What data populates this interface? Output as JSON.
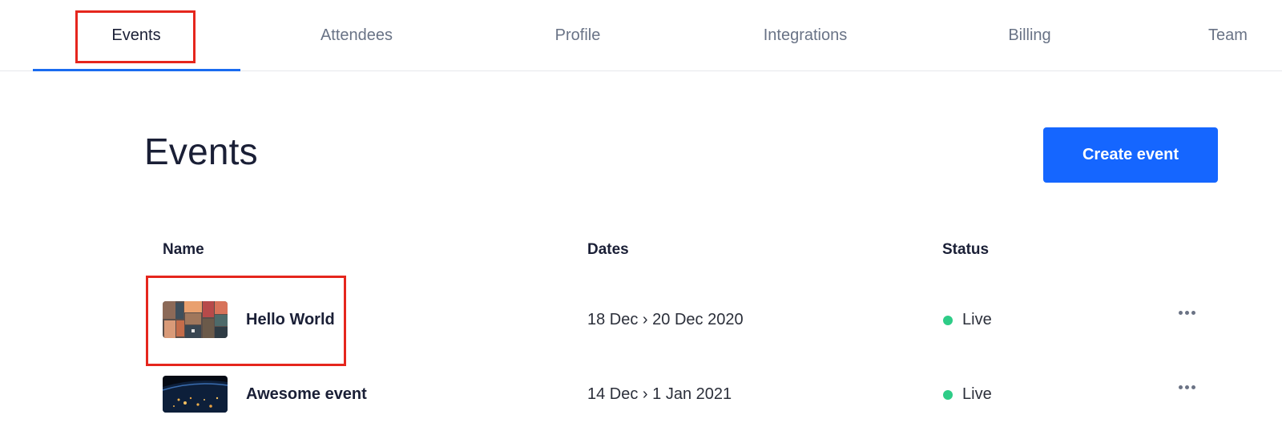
{
  "nav": {
    "tabs": [
      {
        "label": "Events",
        "active": true
      },
      {
        "label": "Attendees",
        "active": false
      },
      {
        "label": "Profile",
        "active": false
      },
      {
        "label": "Integrations",
        "active": false
      },
      {
        "label": "Billing",
        "active": false
      },
      {
        "label": "Team",
        "active": false
      }
    ],
    "accent_color": "#1a6bf0"
  },
  "header": {
    "title": "Events",
    "create_label": "Create event",
    "button_color": "#1566ff"
  },
  "table": {
    "columns": [
      "Name",
      "Dates",
      "Status"
    ],
    "rows": [
      {
        "name": "Hello World",
        "dates": "18 Dec › 20 Dec 2020",
        "status": "Live",
        "status_color": "#2ecc87",
        "thumbnail": "suitcases-photo"
      },
      {
        "name": "Awesome event",
        "dates": "14 Dec › 1 Jan 2021",
        "status": "Live",
        "status_color": "#2ecc87",
        "thumbnail": "earth-at-night-photo"
      }
    ]
  },
  "annotation_color": "#e5261d"
}
